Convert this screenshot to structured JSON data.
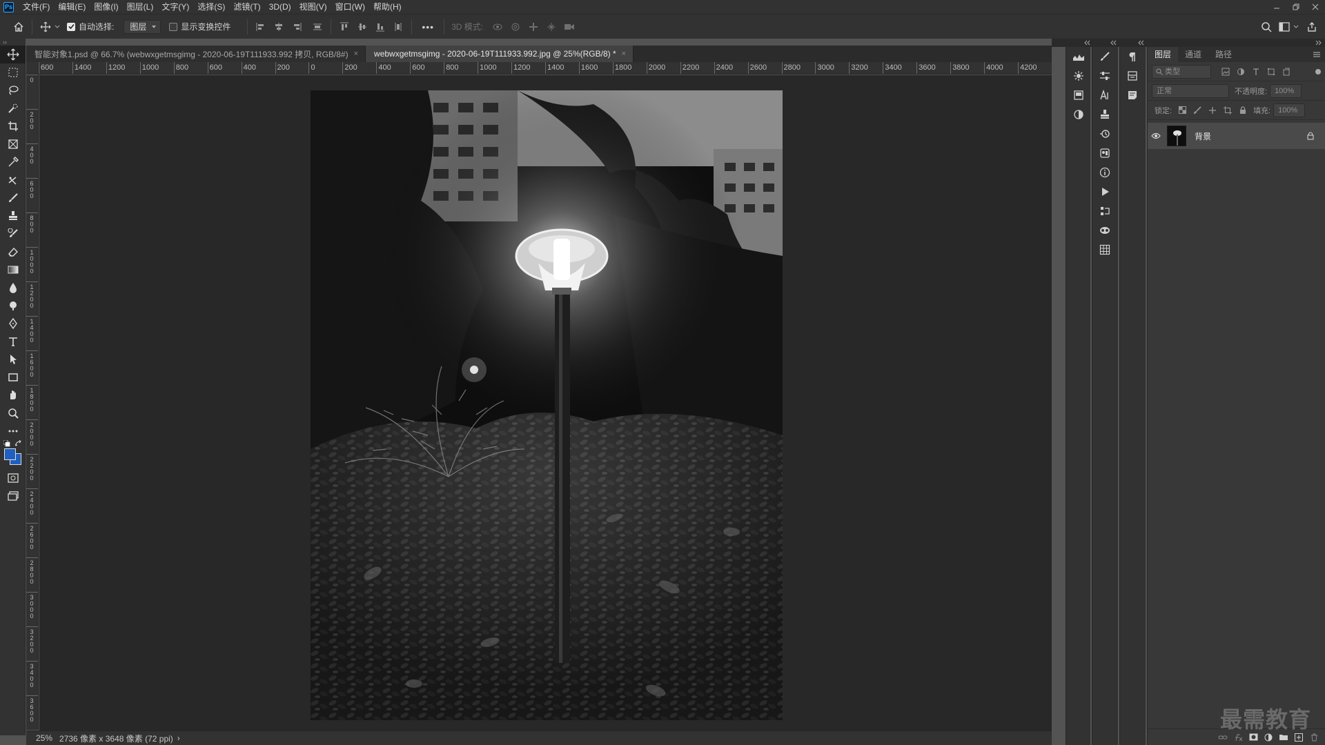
{
  "app": {
    "logo": "Ps"
  },
  "menu": [
    "文件(F)",
    "编辑(E)",
    "图像(I)",
    "图层(L)",
    "文字(Y)",
    "选择(S)",
    "滤镜(T)",
    "3D(D)",
    "视图(V)",
    "窗口(W)",
    "帮助(H)"
  ],
  "options_bar": {
    "auto_select_label": "自动选择:",
    "auto_select_checked": true,
    "auto_select_target": "图层",
    "show_transform_label": "显示变换控件",
    "show_transform_checked": false,
    "more_label": "•••",
    "mode_3d_label": "3D 模式:"
  },
  "tabs": [
    {
      "title": "智能对象1.psd @ 66.7% (webwxgetmsgimg - 2020-06-19T111933.992 拷贝, RGB/8#)",
      "active": false
    },
    {
      "title": "webwxgetmsgimg - 2020-06-19T111933.992.jpg @ 25%(RGB/8) *",
      "active": true
    }
  ],
  "tab_close_glyph": "×",
  "ruler": {
    "h_labels": [
      "600",
      "1400",
      "1200",
      "1000",
      "800",
      "600",
      "400",
      "200",
      "0",
      "200",
      "400",
      "600",
      "800",
      "1000",
      "1200",
      "1400",
      "1600",
      "1800",
      "2000",
      "2200",
      "2400",
      "2600",
      "2800",
      "3000",
      "3200",
      "3400",
      "3600",
      "3800",
      "4000",
      "4200"
    ],
    "v_labels": [
      "0",
      "2 0 0",
      "4 0 0",
      "6 0 0",
      "8 0 0",
      "1 0 0 0",
      "1 2 0 0",
      "1 4 0 0",
      "1 6 0 0",
      "1 8 0 0",
      "2 0 0 0",
      "2 2 0 0",
      "2 4 0 0",
      "2 6 0 0",
      "2 8 0 0",
      "3 0 0 0",
      "3 2 0 0",
      "3 4 0 0",
      "3 6 0 0"
    ]
  },
  "status": {
    "zoom": "25%",
    "doc_info": "2736 像素 x 3648 像素 (72 ppi)",
    "arrow": "›"
  },
  "layers_panel": {
    "tabs": [
      "图层",
      "通道",
      "路径"
    ],
    "active_tab": 0,
    "filter_placeholder": "类型",
    "blend_mode": "正常",
    "opacity_label": "不透明度:",
    "opacity_value": "100%",
    "lock_label": "锁定:",
    "fill_label": "填充:",
    "fill_value": "100%",
    "layers": [
      {
        "name": "背景",
        "visible": true,
        "locked": true
      }
    ]
  },
  "watermark": "最需教育",
  "colors": {
    "foreground": "#1f5fbf",
    "background": "#1f5fbf",
    "accent": "#31a8ff"
  }
}
